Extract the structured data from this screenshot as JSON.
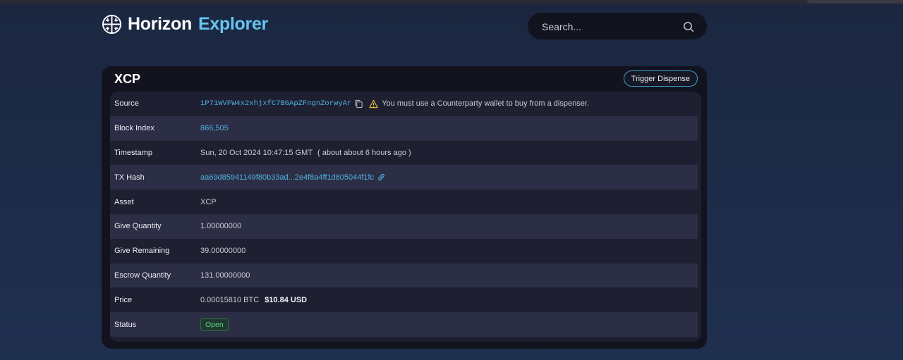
{
  "header": {
    "logo_word1": "Horizon",
    "logo_word2": "Explorer",
    "search_placeholder": "Search..."
  },
  "card": {
    "title": "XCP",
    "trigger_label": "Trigger Dispense",
    "rows": {
      "source": {
        "label": "Source",
        "address": "1P71WVFW4x2xhjxfC7BGApZFngnZorwyAr",
        "warning": "You must use a Counterparty wallet to buy from a dispenser."
      },
      "block_index": {
        "label": "Block Index",
        "value": "866,505"
      },
      "timestamp": {
        "label": "Timestamp",
        "value": "Sun, 20 Oct 2024 10:47:15 GMT",
        "relative": "( about about 6 hours ago )"
      },
      "tx_hash": {
        "label": "TX Hash",
        "value": "aa69d85941149f80b33ad...2e4f8a4ff1d805044f1fc"
      },
      "asset": {
        "label": "Asset",
        "value": "XCP"
      },
      "give_quantity": {
        "label": "Give Quantity",
        "value": "1.00000000"
      },
      "give_remaining": {
        "label": "Give Remaining",
        "value": "39.00000000"
      },
      "escrow_quantity": {
        "label": "Escrow Quantity",
        "value": "131.00000000"
      },
      "price": {
        "label": "Price",
        "btc": "0.00015810 BTC",
        "usd": "$10.84 USD"
      },
      "status": {
        "label": "Status",
        "value": "Open"
      }
    }
  },
  "colors": {
    "accent": "#67c3ef",
    "link": "#4fb0e0",
    "status_open": "#59d18a",
    "warning": "#e8b93a"
  },
  "icons": [
    "logo-icon",
    "search-icon",
    "copy-icon",
    "warning-icon",
    "external-link-icon"
  ]
}
